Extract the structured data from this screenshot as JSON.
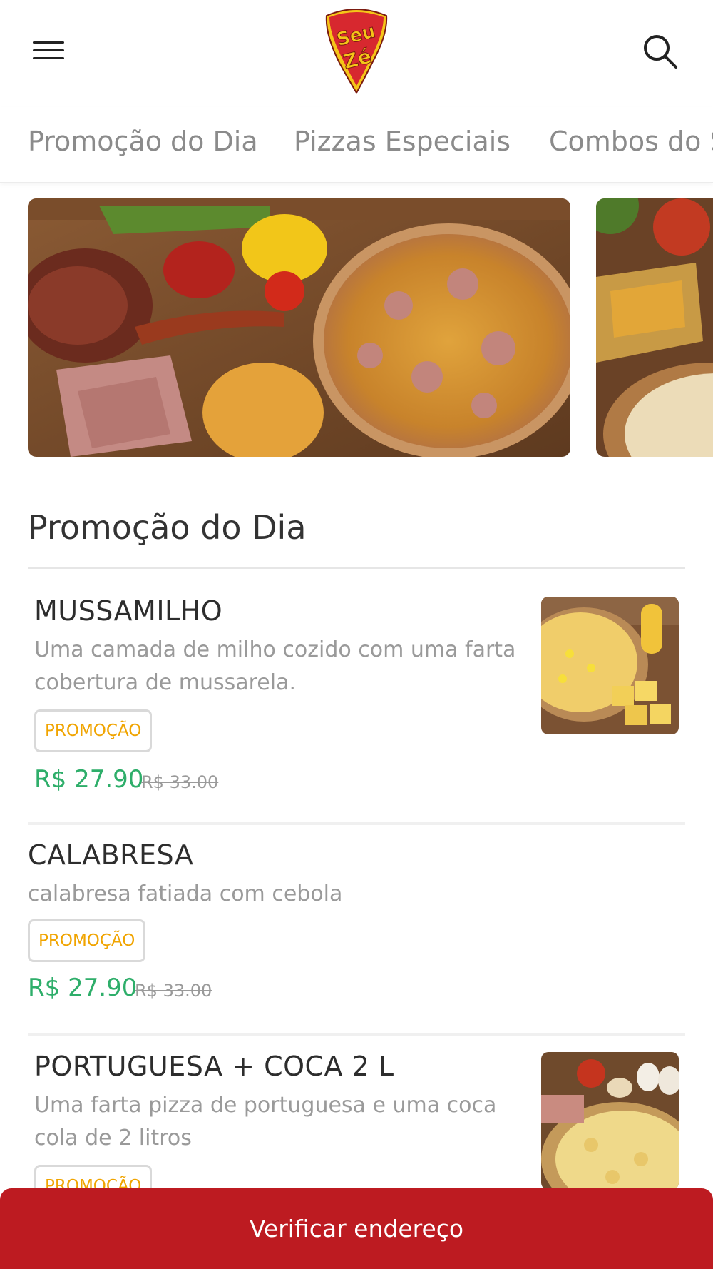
{
  "header": {
    "menu_icon": "hamburger-menu-icon",
    "logo": {
      "text_top": "Seu",
      "text_bottom": "Zé",
      "brand_red": "#d7282f",
      "brand_yellow": "#f5c518"
    },
    "search_icon": "search-icon"
  },
  "tabs": [
    {
      "label": "Promoção do Dia"
    },
    {
      "label": "Pizzas Especiais"
    },
    {
      "label": "Combos do S"
    }
  ],
  "section": {
    "title": "Promoção do Dia"
  },
  "products": [
    {
      "name": "MUSSAMILHO",
      "description": "Uma camada de milho cozido com uma farta cobertura de mussarela.",
      "badge": "PROMOÇÃO",
      "price": "R$ 27.90",
      "old_price": "R$ 33.00"
    },
    {
      "name": "CALABRESA",
      "description": "calabresa fatiada com cebola",
      "badge": "PROMOÇÃO",
      "price": "R$ 27.90",
      "old_price": "R$ 33.00"
    },
    {
      "name": "PORTUGUESA + COCA 2 L",
      "description": "Uma farta pizza de portuguesa e uma coca cola de 2 litros",
      "badge": "PROMOÇÃO"
    }
  ],
  "footer": {
    "button_label": "Verificar endereço",
    "color": "#bd1b21"
  },
  "colors": {
    "price_green": "#2eae6a",
    "badge_orange": "#f0a400",
    "muted_text": "#9a9a9a"
  }
}
